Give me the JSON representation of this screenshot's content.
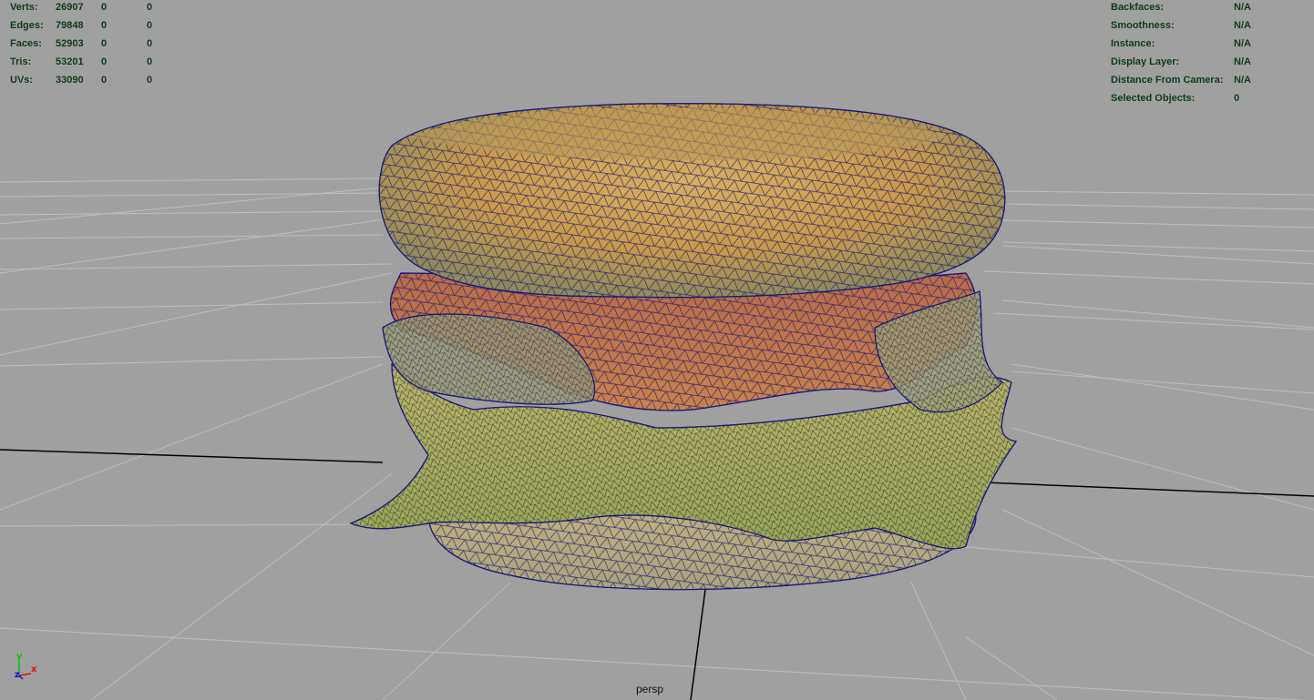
{
  "viewport": {
    "camera_name": "persp",
    "background": "#a0a0a0"
  },
  "hud_left": {
    "rows": [
      {
        "label": "Verts:",
        "total": "26907",
        "selected": "0",
        "component": "0"
      },
      {
        "label": "Edges:",
        "total": "79848",
        "selected": "0",
        "component": "0"
      },
      {
        "label": "Faces:",
        "total": "52903",
        "selected": "0",
        "component": "0"
      },
      {
        "label": "Tris:",
        "total": "53201",
        "selected": "0",
        "component": "0"
      },
      {
        "label": "UVs:",
        "total": "33090",
        "selected": "0",
        "component": "0"
      }
    ]
  },
  "hud_right": {
    "rows": [
      {
        "label": "Backfaces:",
        "value": "N/A"
      },
      {
        "label": "Smoothness:",
        "value": "N/A"
      },
      {
        "label": "Instance:",
        "value": "N/A"
      },
      {
        "label": "Display Layer:",
        "value": "N/A"
      },
      {
        "label": "Distance From Camera:",
        "value": "N/A"
      },
      {
        "label": "Selected Objects:",
        "value": "0"
      }
    ]
  },
  "axis_gizmo": {
    "x_label": "x",
    "y_label": "y",
    "z_label": "z",
    "x_color": "#e01010",
    "y_color": "#10c010",
    "z_color": "#1010e0"
  },
  "model": {
    "name_icon": "burger-mesh-wireframe",
    "wire_color": "#1a1a7a"
  },
  "colors": {
    "hud_text": "#0f3c16",
    "grid_line": "#bcbcbc",
    "grid_axis": "#000000"
  }
}
